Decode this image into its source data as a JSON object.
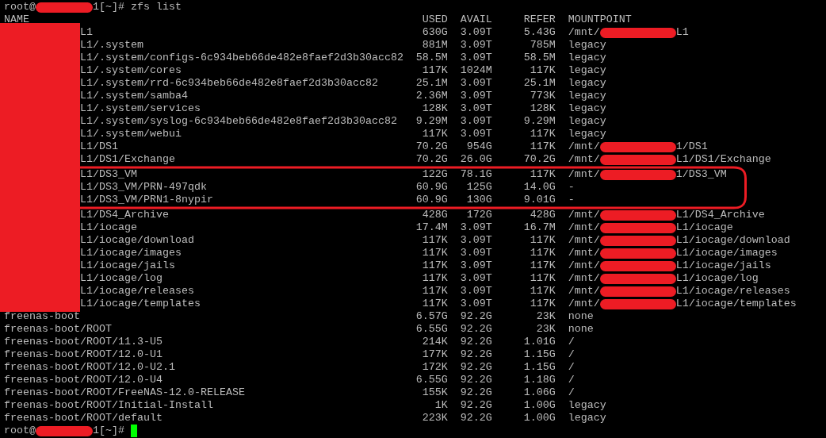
{
  "terminal": {
    "command_prompt": {
      "user": "root@",
      "host_redacted": true,
      "tail": "1[~]#",
      "command": "zfs list"
    },
    "columns": [
      "NAME",
      "USED",
      "AVAIL",
      "REFER",
      "MOUNTPOINT"
    ],
    "pools": [
      {
        "name_redacted": true,
        "datasets": [
          {
            "name": "L1",
            "used": "630G",
            "avail": "3.09T",
            "refer": "5.43G",
            "mountpoint": "/mnt/",
            "mount_redacted": true,
            "mount_tail": "L1",
            "circled": false
          },
          {
            "name": "L1/.system",
            "used": "881M",
            "avail": "3.09T",
            "refer": "785M",
            "mountpoint": "legacy",
            "mount_redacted": false,
            "circled": false
          },
          {
            "name": "L1/.system/configs-6c934beb66de482e8faef2d3b30acc82",
            "used": "58.5M",
            "avail": "3.09T",
            "refer": "58.5M",
            "mountpoint": "legacy",
            "mount_redacted": false,
            "circled": false
          },
          {
            "name": "L1/.system/cores",
            "used": "117K",
            "avail": "1024M",
            "refer": "117K",
            "mountpoint": "legacy",
            "mount_redacted": false,
            "circled": false
          },
          {
            "name": "L1/.system/rrd-6c934beb66de482e8faef2d3b30acc82",
            "used": "25.1M",
            "avail": "3.09T",
            "refer": "25.1M",
            "mountpoint": "legacy",
            "mount_redacted": false,
            "circled": false
          },
          {
            "name": "L1/.system/samba4",
            "used": "2.36M",
            "avail": "3.09T",
            "refer": "773K",
            "mountpoint": "legacy",
            "mount_redacted": false,
            "circled": false
          },
          {
            "name": "L1/.system/services",
            "used": "128K",
            "avail": "3.09T",
            "refer": "128K",
            "mountpoint": "legacy",
            "mount_redacted": false,
            "circled": false
          },
          {
            "name": "L1/.system/syslog-6c934beb66de482e8faef2d3b30acc82",
            "used": "9.29M",
            "avail": "3.09T",
            "refer": "9.29M",
            "mountpoint": "legacy",
            "mount_redacted": false,
            "circled": false
          },
          {
            "name": "L1/.system/webui",
            "used": "117K",
            "avail": "3.09T",
            "refer": "117K",
            "mountpoint": "legacy",
            "mount_redacted": false,
            "circled": false
          },
          {
            "name": "L1/DS1",
            "used": "70.2G",
            "avail": "954G",
            "refer": "117K",
            "mountpoint": "/mnt/",
            "mount_redacted": true,
            "mount_tail": "1/DS1",
            "circled": false
          },
          {
            "name": "L1/DS1/Exchange",
            "used": "70.2G",
            "avail": "26.0G",
            "refer": "70.2G",
            "mountpoint": "/mnt/",
            "mount_redacted": true,
            "mount_tail": "L1/DS1/Exchange",
            "circled": false
          },
          {
            "name": "L1/DS3_VM",
            "used": "122G",
            "avail": "78.1G",
            "refer": "117K",
            "mountpoint": "/mnt/",
            "mount_redacted": true,
            "mount_tail": "1/DS3_VM",
            "circled": true
          },
          {
            "name": "L1/DS3_VM/PRN-497qdk",
            "used": "60.9G",
            "avail": "125G",
            "refer": "14.0G",
            "mountpoint": "-",
            "mount_redacted": false,
            "circled": true
          },
          {
            "name": "L1/DS3_VM/PRN1-8nypir",
            "used": "60.9G",
            "avail": "130G",
            "refer": "9.01G",
            "mountpoint": "-",
            "mount_redacted": false,
            "circled": true
          },
          {
            "name": "L1/DS4_Archive",
            "used": "428G",
            "avail": "172G",
            "refer": "428G",
            "mountpoint": "/mnt/",
            "mount_redacted": true,
            "mount_tail": "L1/DS4_Archive",
            "circled": false
          },
          {
            "name": "L1/iocage",
            "used": "17.4M",
            "avail": "3.09T",
            "refer": "16.7M",
            "mountpoint": "/mnt/",
            "mount_redacted": true,
            "mount_tail": "L1/iocage",
            "circled": false
          },
          {
            "name": "L1/iocage/download",
            "used": "117K",
            "avail": "3.09T",
            "refer": "117K",
            "mountpoint": "/mnt/",
            "mount_redacted": true,
            "mount_tail": "L1/iocage/download",
            "circled": false
          },
          {
            "name": "L1/iocage/images",
            "used": "117K",
            "avail": "3.09T",
            "refer": "117K",
            "mountpoint": "/mnt/",
            "mount_redacted": true,
            "mount_tail": "L1/iocage/images",
            "circled": false
          },
          {
            "name": "L1/iocage/jails",
            "used": "117K",
            "avail": "3.09T",
            "refer": "117K",
            "mountpoint": "/mnt/",
            "mount_redacted": true,
            "mount_tail": "L1/iocage/jails",
            "circled": false
          },
          {
            "name": "L1/iocage/log",
            "used": "117K",
            "avail": "3.09T",
            "refer": "117K",
            "mountpoint": "/mnt/",
            "mount_redacted": true,
            "mount_tail": "L1/iocage/log",
            "circled": false
          },
          {
            "name": "L1/iocage/releases",
            "used": "117K",
            "avail": "3.09T",
            "refer": "117K",
            "mountpoint": "/mnt/",
            "mount_redacted": true,
            "mount_tail": "L1/iocage/releases",
            "circled": false
          },
          {
            "name": "L1/iocage/templates",
            "used": "117K",
            "avail": "3.09T",
            "refer": "117K",
            "mountpoint": "/mnt/",
            "mount_redacted": true,
            "mount_tail": "L1/iocage/templates",
            "circled": false
          }
        ]
      },
      {
        "name_redacted": false,
        "datasets": [
          {
            "name": "freenas-boot",
            "used": "6.57G",
            "avail": "92.2G",
            "refer": "23K",
            "mountpoint": "none",
            "mount_redacted": false,
            "circled": false
          },
          {
            "name": "freenas-boot/ROOT",
            "used": "6.55G",
            "avail": "92.2G",
            "refer": "23K",
            "mountpoint": "none",
            "mount_redacted": false,
            "circled": false
          },
          {
            "name": "freenas-boot/ROOT/11.3-U5",
            "used": "214K",
            "avail": "92.2G",
            "refer": "1.01G",
            "mountpoint": "/",
            "mount_redacted": false,
            "circled": false
          },
          {
            "name": "freenas-boot/ROOT/12.0-U1",
            "used": "177K",
            "avail": "92.2G",
            "refer": "1.15G",
            "mountpoint": "/",
            "mount_redacted": false,
            "circled": false
          },
          {
            "name": "freenas-boot/ROOT/12.0-U2.1",
            "used": "172K",
            "avail": "92.2G",
            "refer": "1.15G",
            "mountpoint": "/",
            "mount_redacted": false,
            "circled": false
          },
          {
            "name": "freenas-boot/ROOT/12.0-U4",
            "used": "6.55G",
            "avail": "92.2G",
            "refer": "1.18G",
            "mountpoint": "/",
            "mount_redacted": false,
            "circled": false
          },
          {
            "name": "freenas-boot/ROOT/FreeNAS-12.0-RELEASE",
            "used": "155K",
            "avail": "92.2G",
            "refer": "1.06G",
            "mountpoint": "/",
            "mount_redacted": false,
            "circled": false
          },
          {
            "name": "freenas-boot/ROOT/Initial-Install",
            "used": "1K",
            "avail": "92.2G",
            "refer": "1.00G",
            "mountpoint": "legacy",
            "mount_redacted": false,
            "circled": false
          },
          {
            "name": "freenas-boot/ROOT/default",
            "used": "223K",
            "avail": "92.2G",
            "refer": "1.00G",
            "mountpoint": "legacy",
            "mount_redacted": false,
            "circled": false
          }
        ]
      }
    ],
    "end_prompt": {
      "user": "root@",
      "host_redacted": true,
      "tail": "1[~]#",
      "cursor": true
    }
  }
}
